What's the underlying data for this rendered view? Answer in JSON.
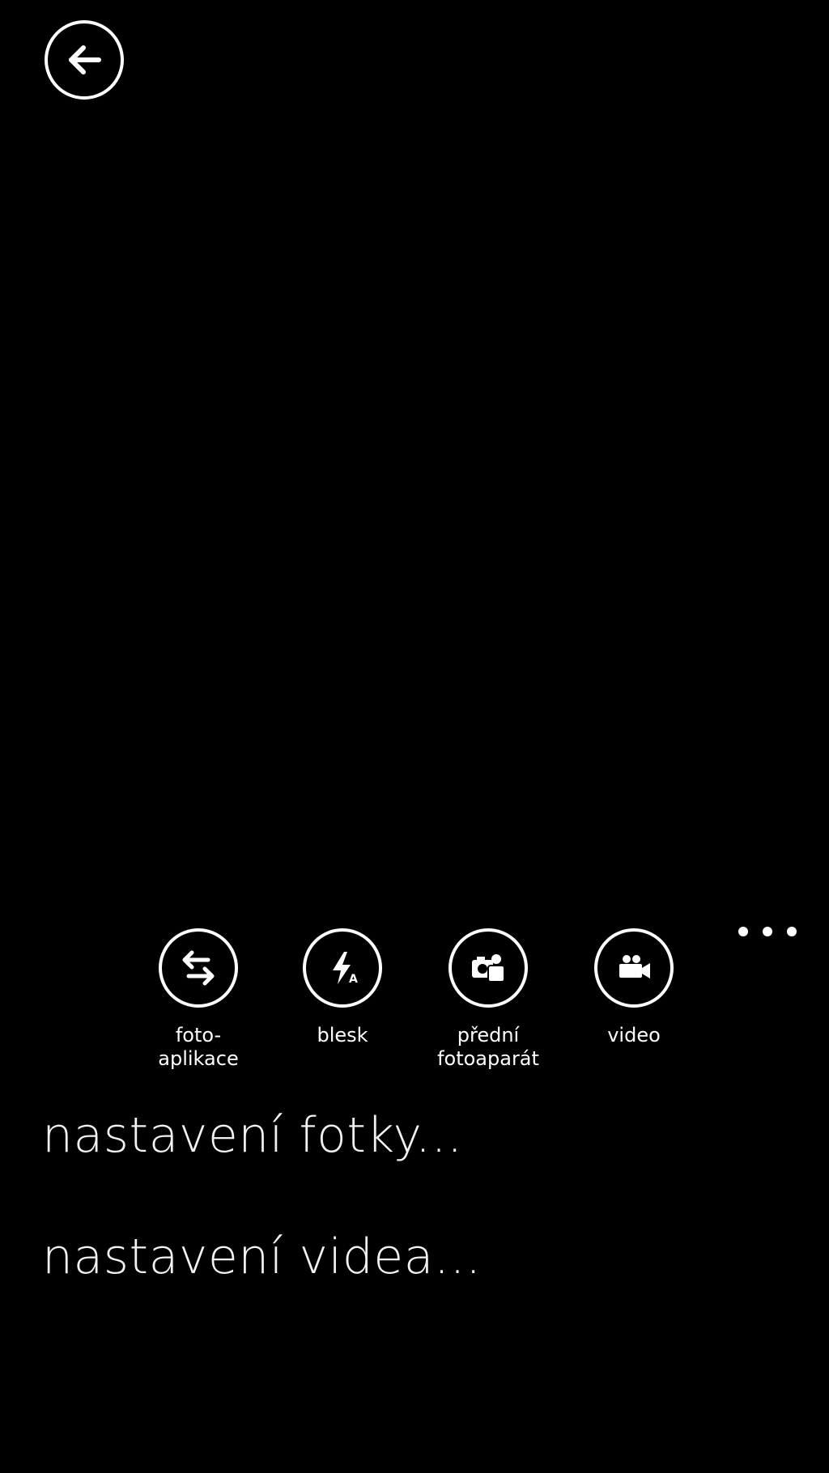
{
  "header": {
    "back_icon": "arrow-left-icon"
  },
  "app_bar": {
    "more_icon": "ellipsis-icon",
    "buttons": [
      {
        "label": "foto-\naplikace",
        "icon": "lens-switch-icon"
      },
      {
        "label": "blesk",
        "icon": "flash-auto-icon"
      },
      {
        "label": "přední\nfotoaparát",
        "icon": "front-camera-icon"
      },
      {
        "label": "video",
        "icon": "video-camera-icon"
      }
    ]
  },
  "menu": {
    "items": [
      {
        "label": "nastavení fotky..."
      },
      {
        "label": "nastavení videa..."
      }
    ]
  }
}
